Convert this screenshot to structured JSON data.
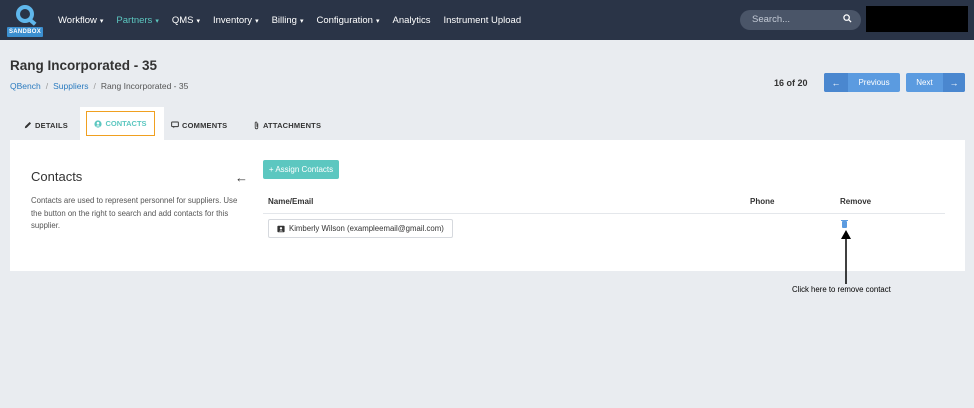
{
  "app": {
    "logo_badge": "SANDBOX"
  },
  "nav": {
    "items": [
      {
        "label": "Workflow",
        "caret": true,
        "active": false
      },
      {
        "label": "Partners",
        "caret": true,
        "active": true
      },
      {
        "label": "QMS",
        "caret": true,
        "active": false
      },
      {
        "label": "Inventory",
        "caret": true,
        "active": false
      },
      {
        "label": "Billing",
        "caret": true,
        "active": false
      },
      {
        "label": "Configuration",
        "caret": true,
        "active": false
      },
      {
        "label": "Analytics",
        "caret": false,
        "active": false
      },
      {
        "label": "Instrument Upload",
        "caret": false,
        "active": false
      }
    ],
    "search_placeholder": "Search..."
  },
  "page": {
    "title": "Rang Incorporated - 35",
    "breadcrumb": {
      "root": "QBench",
      "section": "Suppliers",
      "current": "Rang Incorporated - 35",
      "separator": "/"
    },
    "pager": {
      "position": "16 of 20",
      "previous_label": "Previous",
      "next_label": "Next"
    }
  },
  "tabs": {
    "details": "DETAILS",
    "contacts": "CONTACTS",
    "comments": "COMMENTS",
    "attachments": "ATTACHMENTS"
  },
  "contacts_panel": {
    "title": "Contacts",
    "description": "Contacts are used to represent personnel for suppliers. Use the button on the right to search and add contacts for this supplier.",
    "assign_button": "+ Assign Contacts",
    "columns": {
      "name_email": "Name/Email",
      "phone": "Phone",
      "remove": "Remove"
    },
    "rows": [
      {
        "name_email": "Kimberly Wilson (exampleemail@gmail.com)",
        "phone": ""
      }
    ]
  },
  "annotation": {
    "text": "Click here to remove contact"
  },
  "colors": {
    "nav_bg": "#2a3447",
    "accent_teal": "#5cc7c0",
    "primary_blue": "#5b9be0",
    "highlight_orange": "#f0a020"
  }
}
